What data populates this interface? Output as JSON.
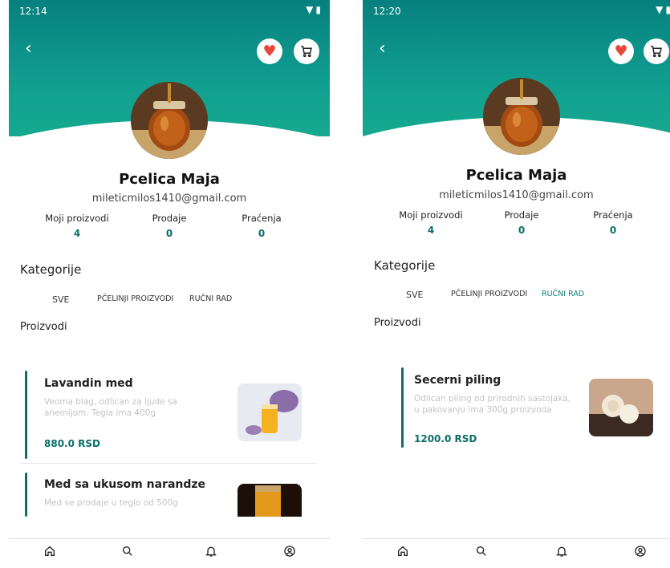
{
  "screens": [
    {
      "time": "12:14",
      "profile": {
        "name": "Pcelica Maja",
        "email": "mileticmilos1410@gmail.com"
      },
      "stats": [
        {
          "label": "Moji proizvodi",
          "value": "4"
        },
        {
          "label": "Prodaje",
          "value": "0"
        },
        {
          "label": "Praćenja",
          "value": "0"
        }
      ],
      "categories_title": "Kategorije",
      "categories": [
        "SVE",
        "PČELINJI PROIZVODI",
        "RUČNI RAD"
      ],
      "active_category": "SVE",
      "products_title": "Proizvodi",
      "products": [
        {
          "title": "Lavandin med",
          "desc": "Veoma blag, odlican za ljude sa anemijom. Tegla ima 400g",
          "price": "880.0 RSD"
        },
        {
          "title": "Med sa ukusom narandze",
          "desc": "Med se prodaje u teglo od 500g",
          "price": ""
        }
      ]
    },
    {
      "time": "12:20",
      "profile": {
        "name": "Pcelica Maja",
        "email": "mileticmilos1410@gmail.com"
      },
      "stats": [
        {
          "label": "Moji proizvodi",
          "value": "4"
        },
        {
          "label": "Prodaje",
          "value": "0"
        },
        {
          "label": "Praćenja",
          "value": "0"
        }
      ],
      "categories_title": "Kategorije",
      "categories": [
        "SVE",
        "PČELINJI PROIZVODI",
        "RUČNI RAD"
      ],
      "active_category": "RUČNI RAD",
      "products_title": "Proizvodi",
      "products": [
        {
          "title": "Secerni piling",
          "desc": "Odlican piling od prirodnih sastojaka, u pakovanju ima 300g proizvoda",
          "price": "1200.0 RSD"
        }
      ]
    }
  ],
  "icons": {
    "back": "back-arrow-icon",
    "favorite": "heart-icon",
    "cart": "cart-icon",
    "nav": [
      "home-icon",
      "search-icon",
      "bell-icon",
      "profile-icon"
    ]
  },
  "colors": {
    "header_top": "#07807f",
    "header_bottom": "#16a88f",
    "accent": "#0b6e6a",
    "heart": "#e8473e"
  }
}
